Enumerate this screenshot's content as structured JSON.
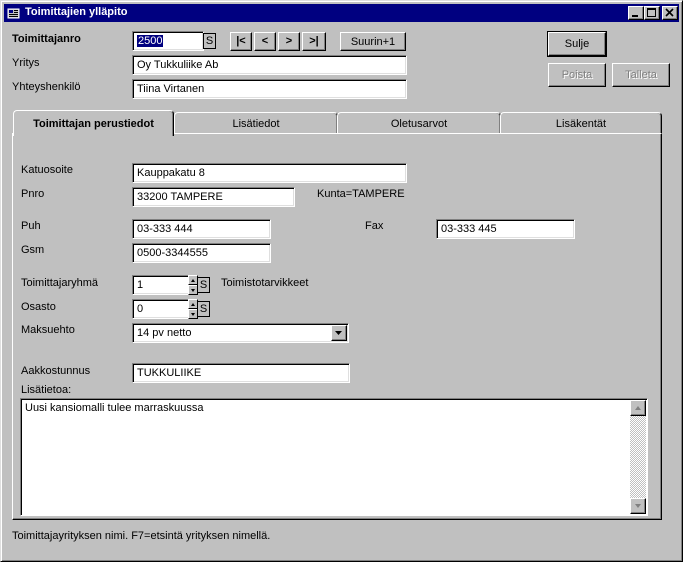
{
  "window": {
    "title": "Toimittajien ylläpito"
  },
  "header": {
    "toimittajanro_label": "Toimittajanro",
    "toimittajanro_value": "2500",
    "s_label": "S",
    "nav_first": "|<",
    "nav_prev": "<",
    "nav_next": ">",
    "nav_last": ">|",
    "suurin_label": "Suurin+1",
    "yritys_label": "Yritys",
    "yritys_value": "Oy Tukkuliike Ab",
    "yhteyshenkilo_label": "Yhteyshenkilö",
    "yhteyshenkilo_value": "Tiina Virtanen"
  },
  "actions": {
    "sulje": "Sulje",
    "poista": "Poista",
    "talleta": "Talleta"
  },
  "tabs": [
    {
      "label": "Toimittajan perustiedot"
    },
    {
      "label": "Lisätiedot"
    },
    {
      "label": "Oletusarvot"
    },
    {
      "label": "Lisäkentät"
    }
  ],
  "form": {
    "katuosoite_label": "Katuosoite",
    "katuosoite_value": "Kauppakatu 8",
    "pnro_label": "Pnro",
    "pnro_value": "33200 TAMPERE",
    "kunta_text": "Kunta=TAMPERE",
    "puh_label": "Puh",
    "puh_value": "03-333 444",
    "fax_label": "Fax",
    "fax_value": "03-333 445",
    "gsm_label": "Gsm",
    "gsm_value": "0500-3344555",
    "ryhma_label": "Toimittajaryhmä",
    "ryhma_value": "1",
    "ryhma_s": "S",
    "ryhma_desc": "Toimistotarvikkeet",
    "osasto_label": "Osasto",
    "osasto_value": "0",
    "osasto_s": "S",
    "maksuehto_label": "Maksuehto",
    "maksuehto_value": "14 pv netto",
    "aakkostunnus_label": "Aakkostunnus",
    "aakkostunnus_value": "TUKKULIIKE",
    "lisatietoa_label": "Lisätietoa:",
    "lisatietoa_value": "Uusi kansiomalli tulee marraskuussa"
  },
  "status": {
    "text": "Toimittajayrityksen nimi. F7=etsintä yrityksen nimellä."
  }
}
